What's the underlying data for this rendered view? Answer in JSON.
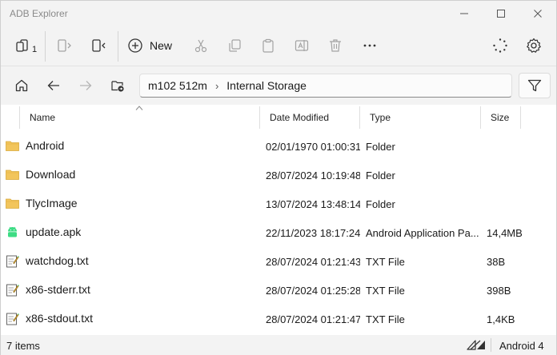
{
  "window": {
    "title": "ADB Explorer"
  },
  "toolbar": {
    "device_count": "1",
    "new_label": "New"
  },
  "navigation": {
    "breadcrumb": [
      "m102 512m",
      "Internal Storage"
    ]
  },
  "columns": {
    "name": "Name",
    "date": "Date Modified",
    "type": "Type",
    "size": "Size"
  },
  "files": [
    {
      "name": "Android",
      "date": "02/01/1970 01:00:31",
      "type": "Folder",
      "size": "",
      "icon": "folder-icon"
    },
    {
      "name": "Download",
      "date": "28/07/2024 10:19:48",
      "type": "Folder",
      "size": "",
      "icon": "folder-icon"
    },
    {
      "name": "TlycImage",
      "date": "13/07/2024 13:48:14",
      "type": "Folder",
      "size": "",
      "icon": "folder-icon"
    },
    {
      "name": "update.apk",
      "date": "22/11/2023 18:17:24",
      "type": "Android Application Pa...",
      "size": "14,4MB",
      "icon": "android-icon"
    },
    {
      "name": "watchdog.txt",
      "date": "28/07/2024 01:21:43",
      "type": "TXT File",
      "size": "38B",
      "icon": "text-file-icon"
    },
    {
      "name": "x86-stderr.txt",
      "date": "28/07/2024 01:25:28",
      "type": "TXT File",
      "size": "398B",
      "icon": "text-file-icon"
    },
    {
      "name": "x86-stdout.txt",
      "date": "28/07/2024 01:21:47",
      "type": "TXT File",
      "size": "1,4KB",
      "icon": "text-file-icon"
    }
  ],
  "status": {
    "item_count": "7 items",
    "device_version": "Android 4"
  },
  "colors": {
    "folder": "#f2c55c",
    "android": "#3ddc84",
    "disabled": "#a3a3a3"
  }
}
